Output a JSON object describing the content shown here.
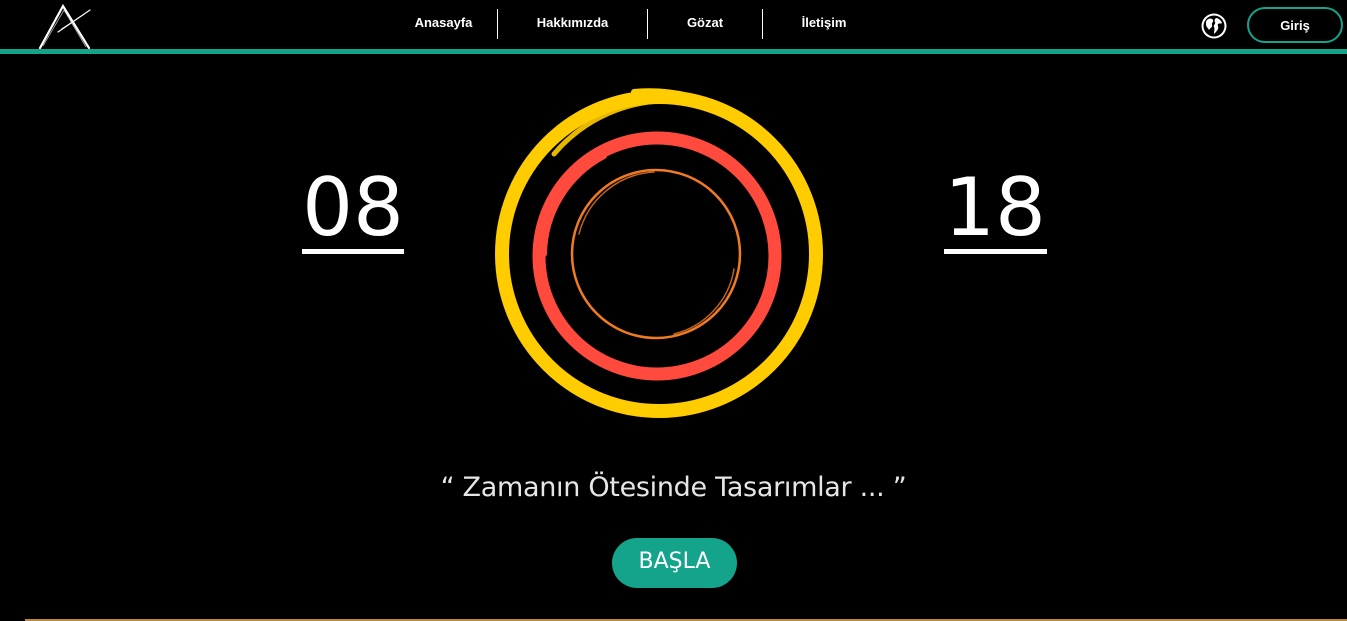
{
  "header": {
    "logo_icon": "a-letter-logo-icon",
    "nav": [
      {
        "label": "Anasayfa"
      },
      {
        "label": "Hakkımızda"
      },
      {
        "label": "Gözat"
      },
      {
        "label": "İletişim"
      }
    ],
    "globe_icon": "globe-icon",
    "login_label": "Giriş"
  },
  "clock": {
    "hours": "08",
    "minutes": "18"
  },
  "tagline": "“ Zamanın Ötesinde Tasarımlar ... ”",
  "start_label": "BAŞLA",
  "colors": {
    "accent": "#14a38b",
    "outer_ring": "#ffcc00",
    "middle_ring": "#ff4a3d",
    "inner_ring": "#f07b22",
    "background": "#000000"
  }
}
